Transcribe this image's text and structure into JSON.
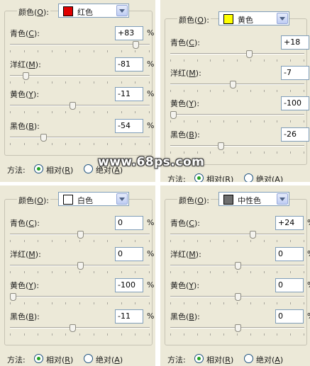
{
  "panels": [
    {
      "color_label": "颜色(",
      "color_key": "O",
      "color_end": "):",
      "selected_color": "红色",
      "swatch": "#e00000",
      "rows": [
        {
          "pre": "青色(",
          "key": "C",
          "post": "):",
          "value": "+83",
          "level": 0.915
        },
        {
          "pre": "洋红(",
          "key": "M",
          "post": "):",
          "value": "-81",
          "level": 0.095
        },
        {
          "pre": "黄色(",
          "key": "Y",
          "post": "):",
          "value": "-11",
          "level": 0.445
        },
        {
          "pre": "黑色(",
          "key": "B",
          "post": "):",
          "value": "-54",
          "level": 0.23
        }
      ],
      "percent": "%",
      "method_label": "方法:",
      "options": [
        {
          "pre": "相对(",
          "key": "R",
          "post": ")",
          "selected": true
        },
        {
          "pre": "绝对(",
          "key": "A",
          "post": ")",
          "selected": false
        }
      ]
    },
    {
      "color_label": "颜色(",
      "color_key": "O",
      "color_end": "):",
      "selected_color": "黄色",
      "swatch": "#ffff00",
      "rows": [
        {
          "pre": "青色(",
          "key": "C",
          "post": "):",
          "value": "+18",
          "level": 0.59
        },
        {
          "pre": "洋红(",
          "key": "M",
          "post": "):",
          "value": "-7",
          "level": 0.465
        },
        {
          "pre": "黄色(",
          "key": "Y",
          "post": "):",
          "value": "-100",
          "level": 0.0
        },
        {
          "pre": "黑色(",
          "key": "B",
          "post": "):",
          "value": "-26",
          "level": 0.37
        }
      ],
      "percent": "%",
      "method_label": "方法:",
      "options": [
        {
          "pre": "相对(",
          "key": "R",
          "post": ")",
          "selected": true
        },
        {
          "pre": "绝对(",
          "key": "A",
          "post": ")",
          "selected": false
        }
      ]
    },
    {
      "color_label": "颜色(",
      "color_key": "O",
      "color_end": "):",
      "selected_color": "白色",
      "swatch": "#ffffff",
      "rows": [
        {
          "pre": "青色(",
          "key": "C",
          "post": "):",
          "value": "0",
          "level": 0.5
        },
        {
          "pre": "洋红(",
          "key": "M",
          "post": "):",
          "value": "0",
          "level": 0.5
        },
        {
          "pre": "黄色(",
          "key": "Y",
          "post": "):",
          "value": "-100",
          "level": 0.0
        },
        {
          "pre": "黑色(",
          "key": "B",
          "post": "):",
          "value": "-11",
          "level": 0.445
        }
      ],
      "percent": "%",
      "method_label": "方法:",
      "options": [
        {
          "pre": "相对(",
          "key": "R",
          "post": ")",
          "selected": true
        },
        {
          "pre": "绝对(",
          "key": "A",
          "post": ")",
          "selected": false
        }
      ]
    },
    {
      "color_label": "颜色(",
      "color_key": "O",
      "color_end": "):",
      "selected_color": "中性色",
      "swatch": "#6e6e6e",
      "rows": [
        {
          "pre": "青色(",
          "key": "C",
          "post": "):",
          "value": "+24",
          "level": 0.62
        },
        {
          "pre": "洋红(",
          "key": "M",
          "post": "):",
          "value": "0",
          "level": 0.5
        },
        {
          "pre": "黄色(",
          "key": "Y",
          "post": "):",
          "value": "0",
          "level": 0.5
        },
        {
          "pre": "黑色(",
          "key": "B",
          "post": "):",
          "value": "0",
          "level": 0.5
        }
      ],
      "percent": "%",
      "method_label": "方法:",
      "options": [
        {
          "pre": "相对(",
          "key": "R",
          "post": ")",
          "selected": true
        },
        {
          "pre": "绝对(",
          "key": "A",
          "post": ")",
          "selected": false
        }
      ]
    }
  ],
  "watermark": "www.68ps.com"
}
